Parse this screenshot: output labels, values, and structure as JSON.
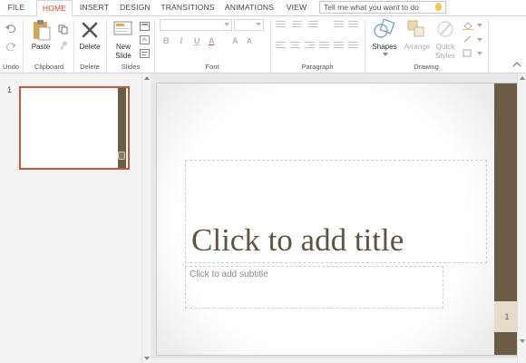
{
  "tabs": {
    "items": [
      {
        "label": "FILE",
        "active": false
      },
      {
        "label": "HOME",
        "active": true
      },
      {
        "label": "INSERT",
        "active": false
      },
      {
        "label": "DESIGN",
        "active": false
      },
      {
        "label": "TRANSITIONS",
        "active": false
      },
      {
        "label": "ANIMATIONS",
        "active": false
      },
      {
        "label": "VIEW",
        "active": false
      }
    ],
    "tell_me_placeholder": "Tell me what you want to do"
  },
  "ribbon": {
    "groups": {
      "undo": "Undo",
      "clipboard": "Clipboard",
      "delete": "Delete",
      "slides": "Slides",
      "font": "Font",
      "paragraph": "Paragraph",
      "drawing": "Drawing"
    },
    "buttons": {
      "paste": "Paste",
      "delete": "Delete",
      "new_slide_line1": "New",
      "new_slide_line2": "Slide",
      "shapes": "Shapes",
      "arrange": "Arrange",
      "quick_styles_line1": "Quick",
      "quick_styles_line2": "Styles"
    },
    "format_glyphs": {
      "bold": "B",
      "italic": "I",
      "underline": "U",
      "font_color": "A",
      "grow": "A",
      "shrink": "A"
    }
  },
  "thumbnails": [
    {
      "number": "1"
    }
  ],
  "slide": {
    "title_placeholder": "Click to add title",
    "subtitle_placeholder": "Click to add subtitle",
    "page_number": "1"
  },
  "colors": {
    "accent": "#d24726",
    "theme_band": "#6a5c45",
    "title_text": "#5e5441"
  }
}
